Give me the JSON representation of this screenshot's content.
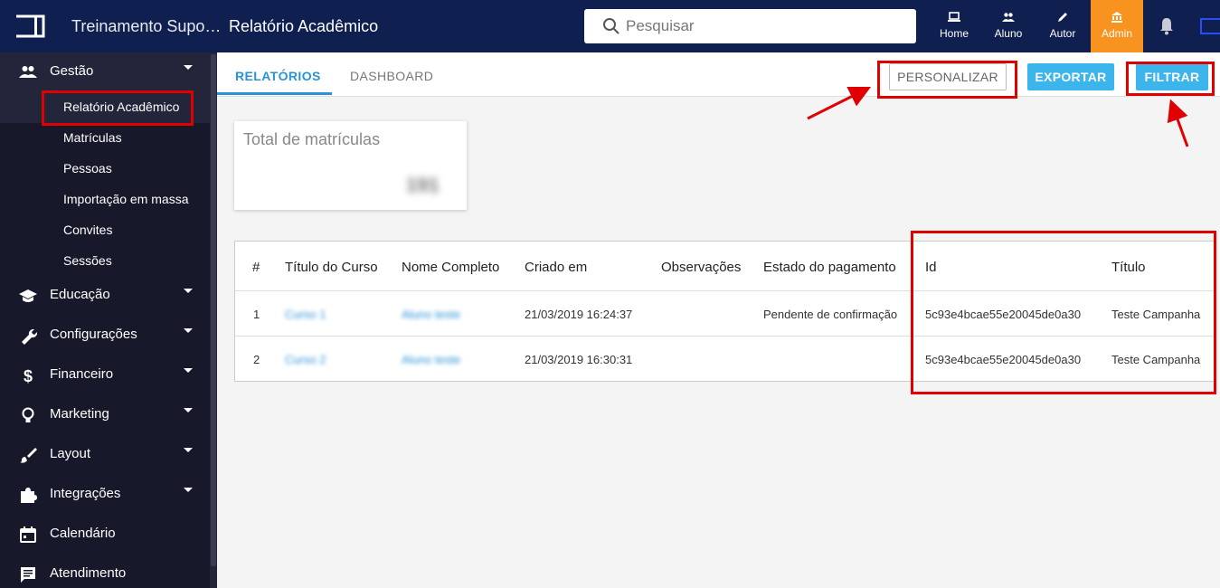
{
  "header": {
    "app_title": "Treinamento Suporte",
    "page_title": "Relatório Acadêmico",
    "search_placeholder": "Pesquisar",
    "nav": {
      "home": "Home",
      "aluno": "Aluno",
      "autor": "Autor",
      "admin": "Admin"
    },
    "colors": {
      "bar": "#0f1f4f",
      "admin_active": "#f7931e"
    }
  },
  "sidebar": {
    "gestao": "Gestão",
    "sub": [
      "Relatório Acadêmico",
      "Matrículas",
      "Pessoas",
      "Importação em massa",
      "Convites",
      "Sessões"
    ],
    "items": [
      "Educação",
      "Configurações",
      "Financeiro",
      "Marketing",
      "Layout",
      "Integrações",
      "Calendário",
      "Atendimento"
    ]
  },
  "tabs": {
    "relatorios": "RELATÓRIOS",
    "dashboard": "DASHBOARD"
  },
  "actions": {
    "personalizar": "PERSONALIZAR",
    "exportar": "EXPORTAR",
    "filtrar": "FILTRAR"
  },
  "card": {
    "title": "Total de matrículas",
    "value": "191"
  },
  "table": {
    "headers": [
      "#",
      "Título do Curso",
      "Nome Completo",
      "Criado em",
      "Observações",
      "Estado do pagamento",
      "Id",
      "Título"
    ],
    "rows": [
      [
        "1",
        "Curso 1",
        "Aluno teste",
        "21/03/2019 16:24:37",
        "",
        "Pendente de confirmação",
        "5c93e4bcae55e20045de0a30",
        "Teste Campanha"
      ],
      [
        "2",
        "Curso 2",
        "Aluno teste",
        "21/03/2019 16:30:31",
        "",
        "",
        "5c93e4bcae55e20045de0a30",
        "Teste Campanha"
      ]
    ]
  },
  "accent_color": "#3cb4ec",
  "annotation_color": "#e00000"
}
